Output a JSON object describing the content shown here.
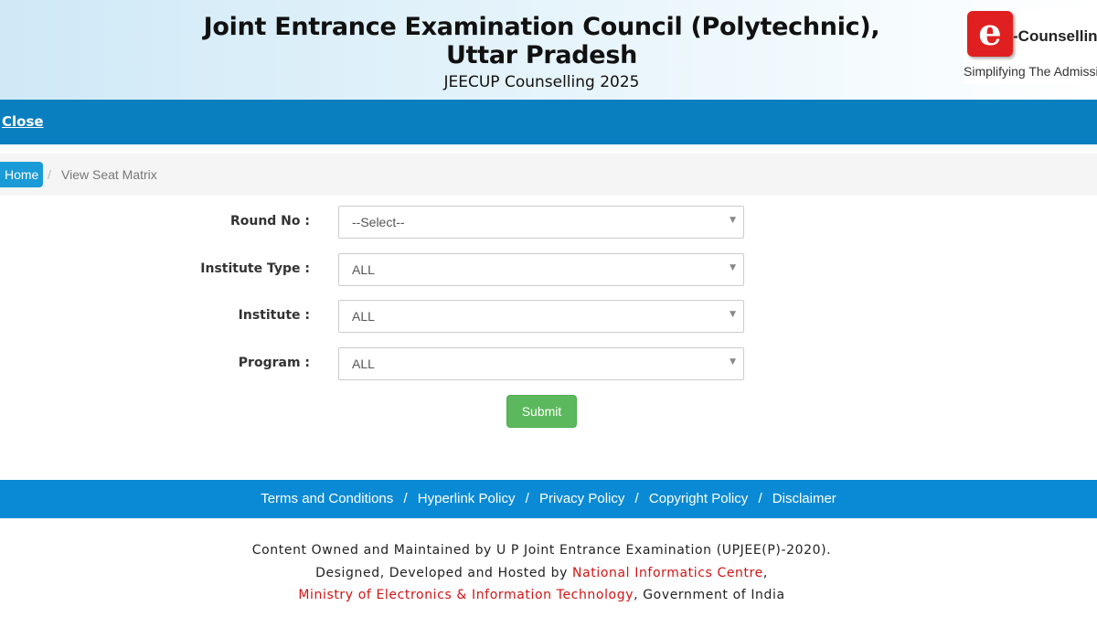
{
  "header": {
    "title_line1": "Joint Entrance Examination Council (Polytechnic),",
    "title_line2": "Uttar Pradesh",
    "subtitle": "JEECUP Counselling 2025",
    "logo": {
      "mark": "e",
      "text": "-Counselling",
      "tagline": "Simplifying The Admission"
    }
  },
  "nav": {
    "close_label": "Close"
  },
  "breadcrumb": {
    "home_label": "Home",
    "separator": "/",
    "current_label": "View Seat Matrix"
  },
  "form": {
    "fields": [
      {
        "label": "Round No :",
        "value": "--Select--"
      },
      {
        "label": "Institute Type :",
        "value": "ALL"
      },
      {
        "label": "Institute :",
        "value": "ALL"
      },
      {
        "label": "Program :",
        "value": "ALL"
      }
    ],
    "submit_label": "Submit"
  },
  "footer": {
    "links": [
      "Terms and Conditions",
      "Hyperlink Policy",
      "Privacy Policy",
      "Copyright Policy",
      "Disclaimer"
    ],
    "link_separator": "/",
    "line1": "Content Owned and Maintained by U P Joint Entrance Examination (UPJEE(P)-2020).",
    "line2_prefix": "Designed, Developed and Hosted by ",
    "line2_link": "National Informatics Centre",
    "line2_suffix": ",",
    "line3_link": "Ministry of Electronics & Information Technology",
    "line3_suffix": ", Government of India"
  },
  "colors": {
    "nav_bar": "#0a7fbf",
    "footer_bar": "#0a8ad4",
    "submit_green": "#5cb85c",
    "link_red": "#d01414",
    "breadcrumb_home": "#1a9ad6"
  }
}
